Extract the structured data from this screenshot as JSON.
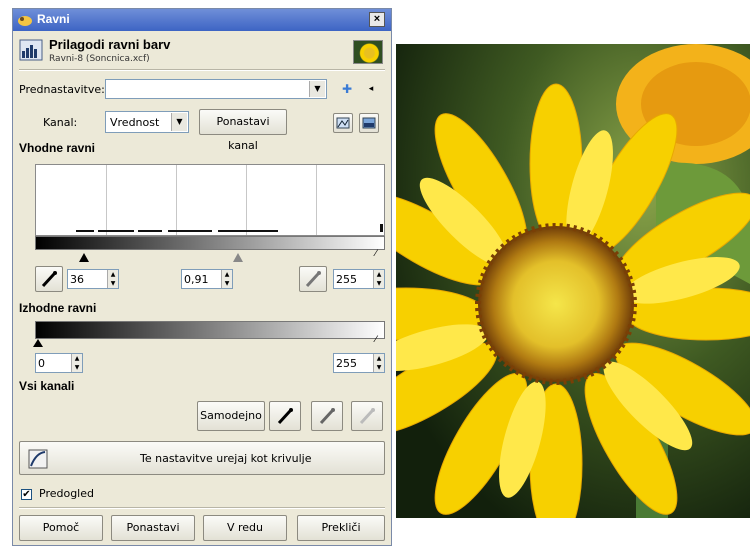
{
  "window": {
    "title": "Ravni",
    "close_label": "×"
  },
  "header": {
    "title": "Prilagodi ravni barv",
    "subtitle": "Ravni-8 (Soncnica.xcf)"
  },
  "presets": {
    "label": "Prednastavitve:",
    "value": ""
  },
  "channel": {
    "label": "Kanal:",
    "value": "Vrednost",
    "reset_label": "Ponastavi kanal"
  },
  "input_levels": {
    "heading": "Vhodne ravni",
    "black": "36",
    "gamma": "0,91",
    "white": "255",
    "low_fraction": 0.14,
    "gamma_fraction": 0.58
  },
  "output_levels": {
    "heading": "Izhodne ravni",
    "low": "0",
    "high": "255"
  },
  "all_channels": {
    "heading": "Vsi kanali",
    "auto_label": "Samodejno"
  },
  "curves_button": "Te nastavitve urejaj kot krivulje",
  "preview": {
    "label": "Predogled",
    "checked": true,
    "check_mark": "✔"
  },
  "buttons": {
    "help": "Pomoč",
    "reset": "Ponastavi",
    "ok": "V redu",
    "cancel": "Prekliči"
  },
  "colors": {
    "titlebar": "#3d64c4",
    "dialog_bg": "#ece9d8",
    "flower_yellow": "#f7d000"
  }
}
